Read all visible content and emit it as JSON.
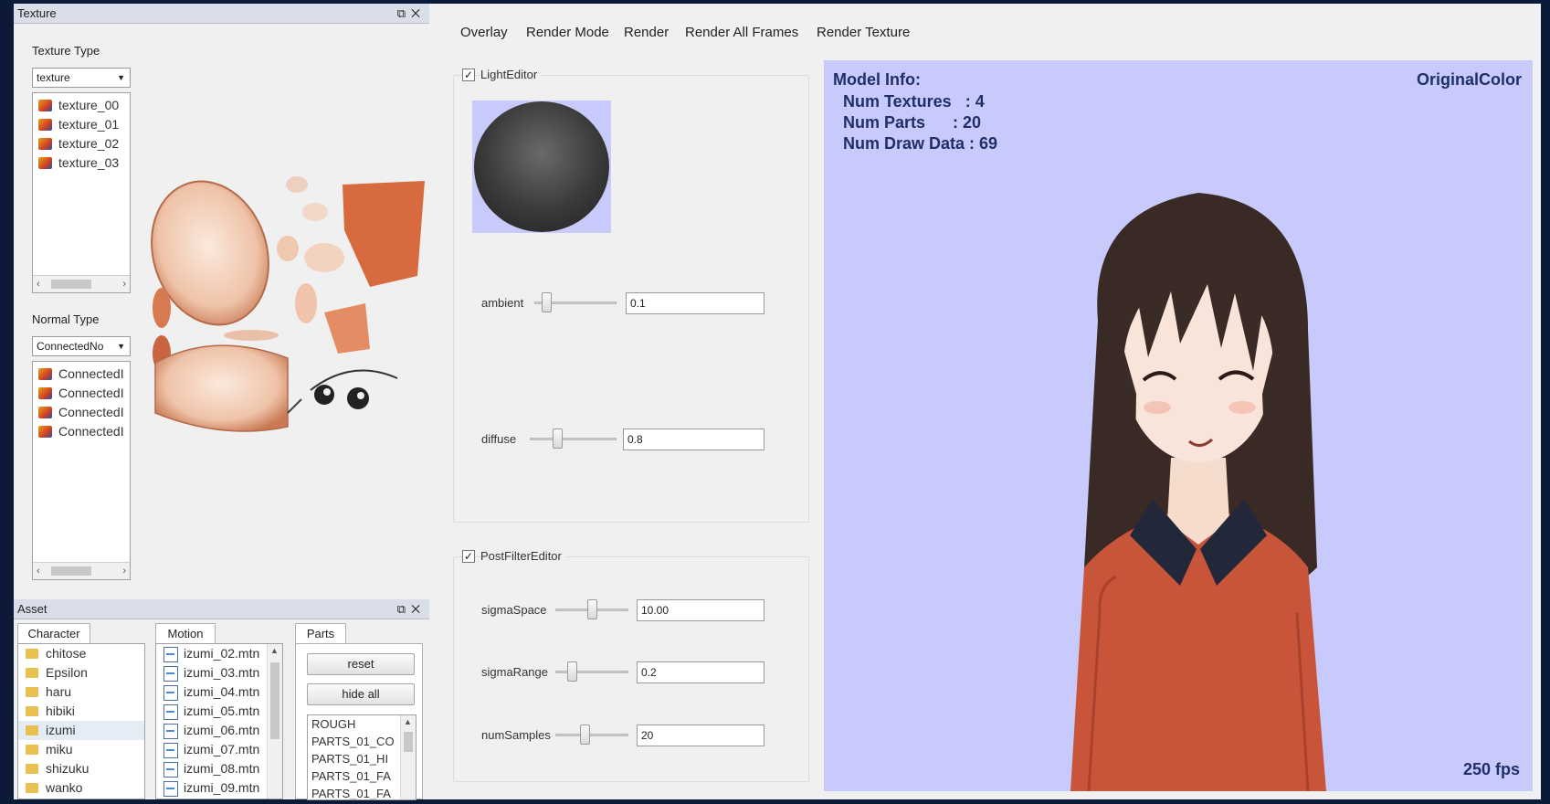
{
  "texture_panel": {
    "title": "Texture",
    "texture_type_label": "Texture Type",
    "texture_type_value": "texture",
    "textures": [
      "texture_00",
      "texture_01",
      "texture_02",
      "texture_03"
    ],
    "normal_type_label": "Normal Type",
    "normal_type_value": "ConnectedNo",
    "normals": [
      "ConnectedI",
      "ConnectedI",
      "ConnectedI",
      "ConnectedI"
    ]
  },
  "asset_panel": {
    "title": "Asset",
    "tabs": [
      "Character",
      "Motion",
      "Parts"
    ],
    "characters": [
      "chitose",
      "Epsilon",
      "haru",
      "hibiki",
      "izumi",
      "miku",
      "shizuku",
      "wanko"
    ],
    "selected_character": "izumi",
    "motions": [
      "izumi_02.mtn",
      "izumi_03.mtn",
      "izumi_04.mtn",
      "izumi_05.mtn",
      "izumi_06.mtn",
      "izumi_07.mtn",
      "izumi_08.mtn",
      "izumi_09.mtn"
    ],
    "reset_label": "reset",
    "hide_all_label": "hide all",
    "parts": [
      "ROUGH",
      "PARTS_01_CO",
      "PARTS_01_HI",
      "PARTS_01_FA",
      "PARTS_01_FA"
    ]
  },
  "menu": {
    "items": [
      "Overlay",
      "Render Mode",
      "Render",
      "Render All Frames",
      "Render Texture"
    ]
  },
  "light_editor": {
    "title": "LightEditor",
    "checked": true,
    "ambient_label": "ambient",
    "ambient_value": "0.1",
    "ambient_level": 0.1,
    "diffuse_label": "diffuse",
    "diffuse_value": "0.8",
    "diffuse_level": 0.3
  },
  "post_filter_editor": {
    "title": "PostFilterEditor",
    "checked": true,
    "sigma_space_label": "sigmaSpace",
    "sigma_space_value": "10.00",
    "sigma_range_label": "sigmaRange",
    "sigma_range_value": "0.2",
    "num_samples_label": "numSamples",
    "num_samples_value": "20"
  },
  "viewport": {
    "model_info_title": "Model Info:",
    "num_textures": "Num Textures   : 4",
    "num_parts": "Num Parts      : 20",
    "num_draw_data": "Num Draw Data : 69",
    "mode": "OriginalColor",
    "fps": "250 fps",
    "background_color": "#c8cafb"
  }
}
